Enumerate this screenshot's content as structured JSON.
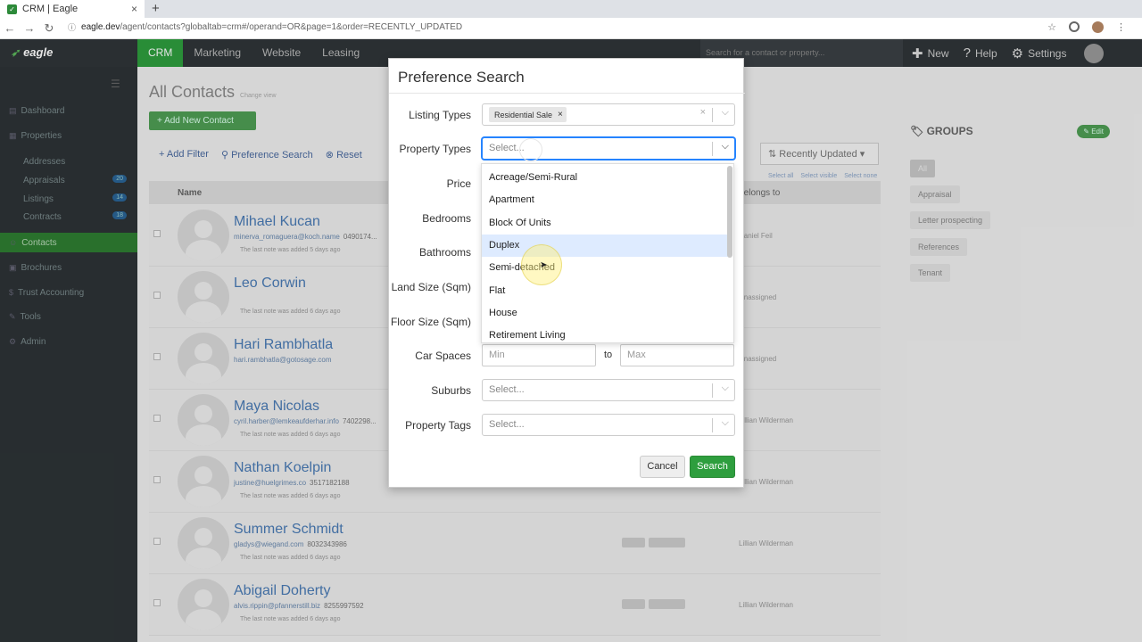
{
  "browser": {
    "tab_title": "CRM | Eagle",
    "url_host": "eagle.dev",
    "url_path": "/agent/contacts?globaltab=crm#/operand=OR&page=1&order=RECENTLY_UPDATED"
  },
  "app": {
    "logo": "eagle",
    "menu": [
      "CRM",
      "Marketing",
      "Website",
      "Leasing"
    ],
    "search_placeholder": "Search for a contact or property...",
    "new_label": "New",
    "help_label": "Help",
    "settings_label": "Settings"
  },
  "sidebar": {
    "items": [
      {
        "label": "Dashboard"
      },
      {
        "label": "Properties"
      },
      {
        "label": "Addresses"
      },
      {
        "label": "Appraisals",
        "badge": "20"
      },
      {
        "label": "Listings",
        "badge": "14"
      },
      {
        "label": "Contracts",
        "badge": "18"
      },
      {
        "label": "Contacts"
      },
      {
        "label": "Brochures"
      },
      {
        "label": "Trust Accounting"
      },
      {
        "label": "Tools"
      },
      {
        "label": "Admin"
      }
    ]
  },
  "page": {
    "title": "All Contacts",
    "change_view": "Change view",
    "add_button": "+ Add New Contact",
    "add_filter": "Add Filter",
    "pref_search": "Preference Search",
    "reset": "Reset",
    "sort": "Recently Updated",
    "select_all": "Select all",
    "select_visible": "Select visible",
    "select_none": "Select none",
    "col_name": "Name",
    "col_belongs": "Belongs to"
  },
  "contacts": [
    {
      "name": "Mihael Kucan",
      "email": "minerva_romaguera@koch.name",
      "phone": "0490174...",
      "note": "The last note was added 5 days ago",
      "owner": "Daniel Feil"
    },
    {
      "name": "Leo Corwin",
      "email": "",
      "phone": "",
      "note": "The last note was added 6 days ago",
      "owner": "Unassigned"
    },
    {
      "name": "Hari Rambhatla",
      "email": "hari.rambhatla@gotosage.com",
      "phone": "",
      "note": "",
      "owner": "Unassigned"
    },
    {
      "name": "Maya Nicolas",
      "email": "cyril.harber@lemkeaufderhar.info",
      "phone": "7402298...",
      "note": "The last note was added 6 days ago",
      "owner": "Lillian Wilderman"
    },
    {
      "name": "Nathan Koelpin",
      "email": "justine@huelgrimes.co",
      "phone": "3517182188",
      "note": "The last note was added 6 days ago",
      "owner": "Lillian Wilderman"
    },
    {
      "name": "Summer Schmidt",
      "email": "gladys@wiegand.com",
      "phone": "8032343986",
      "note": "The last note was added 6 days ago",
      "owner": "Lillian Wilderman"
    },
    {
      "name": "Abigail Doherty",
      "email": "alvis.rippin@pfannerstill.biz",
      "phone": "8255997592",
      "note": "The last note was added 6 days ago",
      "owner": "Lillian Wilderman"
    }
  ],
  "groups": {
    "title": "GROUPS",
    "edit": "Edit",
    "items": [
      "All",
      "Appraisal",
      "Letter prospecting",
      "References",
      "Tenant"
    ]
  },
  "modal": {
    "title": "Preference Search",
    "listing_types_label": "Listing Types",
    "listing_types_value": "Residential Sale",
    "property_types_label": "Property Types",
    "select_placeholder": "Select...",
    "price_label": "Price",
    "bedrooms_label": "Bedrooms",
    "bathrooms_label": "Bathrooms",
    "land_label": "Land Size (Sqm)",
    "floor_label": "Floor Size (Sqm)",
    "car_label": "Car Spaces",
    "min": "Min",
    "to": "to",
    "max": "Max",
    "suburbs_label": "Suburbs",
    "tags_label": "Property Tags",
    "cancel": "Cancel",
    "search": "Search",
    "options": [
      "Acreage/Semi-Rural",
      "Apartment",
      "Block Of Units",
      "Duplex",
      "Semi-detached",
      "Flat",
      "House",
      "Retirement Living"
    ],
    "highlighted": "Duplex"
  }
}
